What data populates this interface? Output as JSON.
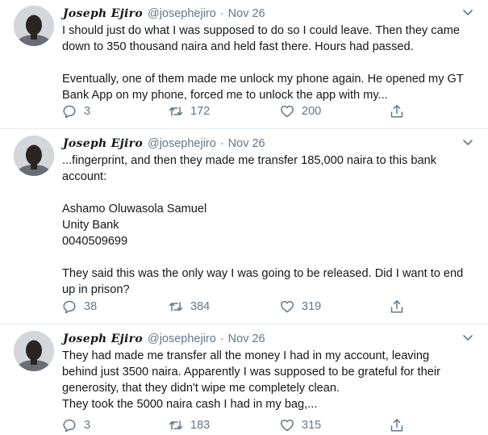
{
  "tweets": [
    {
      "name": "Joseph Ejiro",
      "handle": "@josephejiro",
      "separator": "·",
      "date": "Nov 26",
      "lines": [
        "I should just do what I was supposed to do so I could leave. Then they came",
        "down to 350 thousand naira and held fast there. Hours had passed.",
        "",
        "Eventually, one of them made me unlock my phone again. He opened my GT",
        "Bank App on my phone, forced me to unlock the app with my..."
      ],
      "replies": "3",
      "retweets": "172",
      "likes": "200"
    },
    {
      "name": "Joseph Ejiro",
      "handle": "@josephejiro",
      "separator": "·",
      "date": "Nov 26",
      "lines": [
        "...fingerprint, and then they made me transfer 185,000 naira to this bank",
        "account:",
        "",
        "Ashamo Oluwasola Samuel",
        "Unity Bank",
        "0040509699",
        "",
        "They said this was the only way I was going to be released. Did I want to end",
        "up in prison?"
      ],
      "replies": "38",
      "retweets": "384",
      "likes": "319"
    },
    {
      "name": "Joseph Ejiro",
      "handle": "@josephejiro",
      "separator": "·",
      "date": "Nov 26",
      "lines": [
        "They had made me transfer all the money I had in my account, leaving",
        "behind just 3500 naira. Apparently I was supposed to be grateful for their",
        "generosity, that they didn't wipe me completely clean.",
        "They took the 5000 naira cash I had in my bag,..."
      ],
      "replies": "3",
      "retweets": "183",
      "likes": "315"
    }
  ],
  "icons": {
    "reply": "reply-icon",
    "retweet": "retweet-icon",
    "like": "heart-icon",
    "share": "share-icon",
    "more": "chevron-down-icon"
  },
  "colors": {
    "text": "#14171a",
    "secondary": "#657786",
    "divider": "#e6ecf0"
  }
}
